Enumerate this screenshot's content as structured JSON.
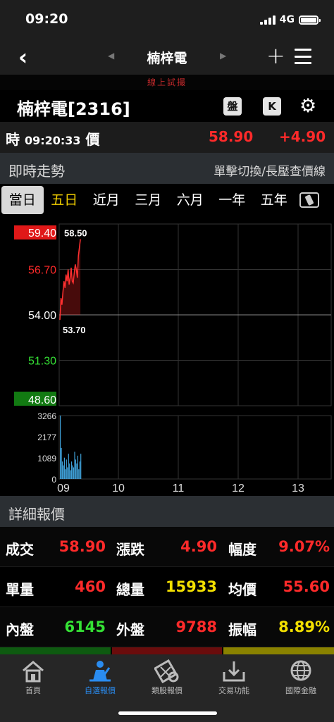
{
  "status": {
    "time": "09:20",
    "network": "4G"
  },
  "nav": {
    "back": "‹",
    "prev": "◀",
    "title": "楠梓電",
    "next": "▶",
    "add": "+"
  },
  "trial_label": "線上試撮",
  "stock": {
    "name": "楠梓電[2316]",
    "btn_pan": "盤",
    "btn_k": "K",
    "gear": "⚙"
  },
  "quote": {
    "time_label": "時",
    "time": "09:20:33",
    "price_label": "價",
    "price": "58.90",
    "change": "+4.90"
  },
  "intraday": {
    "title": "即時走勢",
    "hint": "單擊切換/長壓查價線"
  },
  "tabs": [
    "當日",
    "五日",
    "近月",
    "三月",
    "六月",
    "一年",
    "五年"
  ],
  "colors": {
    "up": "#ff2a2a",
    "down": "#35e235",
    "flat": "#f3e000",
    "accent": "#2a8cf0",
    "volume": "#3f9fd6"
  },
  "chart_data": {
    "type": "line",
    "price_axis": [
      "59.40",
      "56.70",
      "54.00",
      "51.30",
      "48.60"
    ],
    "price_range": [
      48.6,
      59.4
    ],
    "reference_price": 54.0,
    "high_label": "58.50",
    "low_label": "53.70",
    "volume_axis": [
      "3266",
      "2177",
      "1089",
      "0"
    ],
    "volume_range": [
      0,
      3266
    ],
    "time_axis": [
      "09",
      "10",
      "11",
      "12",
      "13"
    ],
    "series": [
      {
        "values": [
          53.7,
          55.0,
          54.6,
          55.4,
          56.0,
          55.6,
          56.4,
          56.0,
          56.7,
          55.8,
          56.2,
          56.8,
          56.0,
          55.9,
          56.5,
          57.0,
          56.7,
          56.2,
          57.5,
          58.0,
          58.5
        ]
      }
    ],
    "volume": [
      3266,
      1600,
      900,
      700,
      1100,
      500,
      1000,
      600,
      1300,
      800,
      450,
      900,
      700,
      600,
      1400,
      1000,
      800,
      1200,
      500,
      900,
      1300
    ]
  },
  "details": {
    "title": "詳細報價",
    "rows": [
      [
        {
          "label": "成交",
          "value": "58.90",
          "color": "red"
        },
        {
          "label": "漲跌",
          "value": "4.90",
          "color": "red"
        },
        {
          "label": "幅度",
          "value": "9.07%",
          "color": "red"
        }
      ],
      [
        {
          "label": "單量",
          "value": "460",
          "color": "red"
        },
        {
          "label": "總量",
          "value": "15933",
          "color": "yellow"
        },
        {
          "label": "均價",
          "value": "55.60",
          "color": "red"
        }
      ],
      [
        {
          "label": "內盤",
          "value": "6145",
          "color": "green"
        },
        {
          "label": "外盤",
          "value": "9788",
          "color": "red"
        },
        {
          "label": "振幅",
          "value": "8.89%",
          "color": "yellow"
        }
      ]
    ]
  },
  "tabbar": [
    {
      "label": "首頁",
      "icon": "home-icon"
    },
    {
      "label": "自選報價",
      "icon": "watchlist-icon"
    },
    {
      "label": "類股報價",
      "icon": "sector-icon"
    },
    {
      "label": "交易功能",
      "icon": "trade-icon"
    },
    {
      "label": "國際金融",
      "icon": "globe-icon"
    }
  ]
}
